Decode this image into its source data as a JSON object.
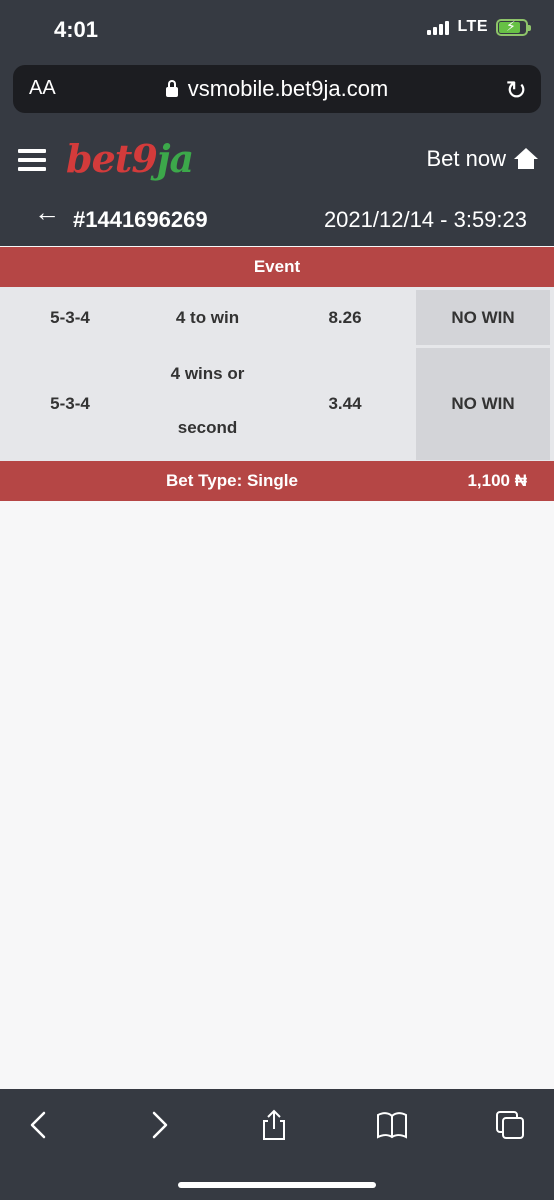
{
  "status": {
    "time": "4:01",
    "network": "LTE"
  },
  "browser": {
    "text_size_label": "AA",
    "url": "vsmobile.bet9ja.com"
  },
  "header": {
    "logo_text": "bet9ja",
    "bet_now_label": "Bet now",
    "bet_id": "#1441696269",
    "bet_datetime": "2021/12/14 - 3:59:23"
  },
  "table": {
    "header": "Event",
    "rows": [
      {
        "code": "5-3-4",
        "market": "4 to win",
        "odds": "8.26",
        "result": "NO WIN"
      },
      {
        "code": "5-3-4",
        "market_line1": "4 wins or",
        "market_line2": "second",
        "odds": "3.44",
        "result": "NO WIN"
      }
    ],
    "footer": {
      "bet_type": "Bet Type: Single",
      "amount": "1,100 ₦"
    }
  },
  "colors": {
    "header_bg": "#363a42",
    "accent_red": "#b54645",
    "logo_red": "#d33b3b",
    "logo_green": "#3ca84a"
  }
}
